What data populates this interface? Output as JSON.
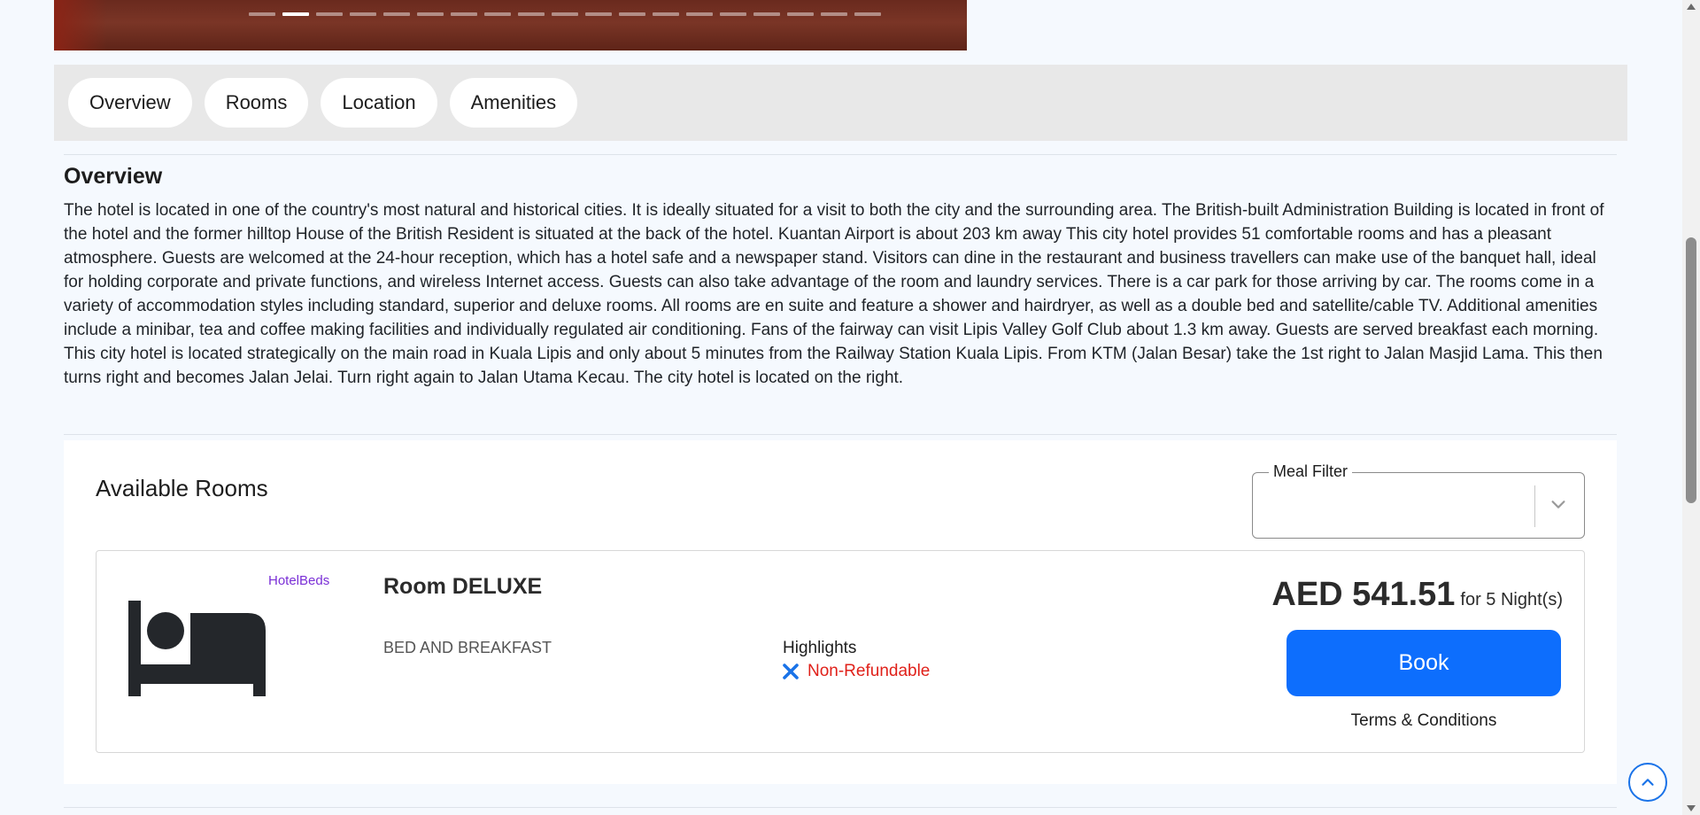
{
  "gallery": {
    "slide_count": 19,
    "active_index": 1
  },
  "tabs": [
    {
      "label": "Overview"
    },
    {
      "label": "Rooms"
    },
    {
      "label": "Location"
    },
    {
      "label": "Amenities"
    }
  ],
  "overview": {
    "title": "Overview",
    "text": "The hotel is located in one of the country's most natural and historical cities. It is ideally situated for a visit to both the city and the surrounding area. The British-built Administration Building is located in front of the hotel and the former hilltop House of the British Resident is situated at the back of the hotel. Kuantan Airport is about 203 km away This city hotel provides 51 comfortable rooms and has a pleasant atmosphere. Guests are welcomed at the 24-hour reception, which has a hotel safe and a newspaper stand. Visitors can dine in the restaurant and business travellers can make use of the banquet hall, ideal for holding corporate and private functions, and wireless Internet access. Guests can also take advantage of the room and laundry services. There is a car park for those arriving by car. The rooms come in a variety of accommodation styles including standard, superior and deluxe rooms. All rooms are en suite and feature a shower and hairdryer, as well as a double bed and satellite/cable TV. Additional amenities include a minibar, tea and coffee making facilities and individually regulated air conditioning. Fans of the fairway can visit Lipis Valley Golf Club about 1.3 km away. Guests are served breakfast each morning. This city hotel is located strategically on the main road in Kuala Lipis and only about 5 minutes from the Railway Station Kuala Lipis. From KTM (Jalan Besar) take the 1st right to Jalan Masjid Lama. This then turns right and becomes Jalan Jelai. Turn right again to Jalan Utama Kecau. The city hotel is located on the right."
  },
  "rooms": {
    "title": "Available Rooms",
    "meal_filter": {
      "label": "Meal Filter",
      "value": ""
    },
    "items": [
      {
        "provider": "HotelBeds",
        "name": "Room DELUXE",
        "board": "BED AND BREAKFAST",
        "highlights_label": "Highlights",
        "refund_policy": "Non-Refundable",
        "price": "AED 541.51",
        "nights": "for 5 Night(s)",
        "book_label": "Book",
        "terms_label": "Terms & Conditions"
      }
    ]
  },
  "colors": {
    "primary": "#0d6efd",
    "provider": "#7a2fd6",
    "non_refundable": "#e0211a",
    "page_background": "#f5f9fe",
    "tabbar_background": "#e8e8e8"
  },
  "icons": {
    "room": "bed-icon",
    "refund": "x-icon",
    "meal_filter": "chevron-down-icon",
    "scroll_top": "chevron-up-icon"
  }
}
